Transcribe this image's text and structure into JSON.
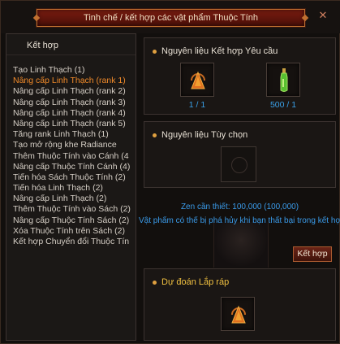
{
  "window": {
    "title": "Tinh chế / kết hợp các vật phẩm Thuộc Tính",
    "close_label": "✕"
  },
  "left": {
    "header": "Kết hợp",
    "items": [
      "Tạo Linh Thạch (1)",
      "Nâng cấp Linh Thạch (rank 1)",
      "Nâng cấp Linh Thạch (rank 2)",
      "Nâng cấp Linh Thạch (rank 3)",
      "Nâng cấp Linh Thạch (rank 4)",
      "Nâng cấp Linh Thạch (rank 5)",
      "Tăng rank Linh Thạch (1)",
      "Tạo mở rộng khe Radiance",
      "Thêm Thuộc Tính vào Cánh (4",
      "Nâng cấp Thuộc Tính Cánh (4)",
      "Tiến hóa Sách Thuộc Tính (2)",
      "Tiến hóa Linh Thạch (2)",
      "Nâng cấp Linh Thạch (2)",
      "Thêm Thuộc Tính vào Sách (2)",
      "Nâng cấp Thuộc Tính Sách (2)",
      "Xóa Thuộc Tính trên Sách (2)",
      "Kết hợp Chuyển đổi Thuộc Tín"
    ],
    "active_index": 1
  },
  "required": {
    "title": "Nguyên liệu Kết hợp Yêu cầu",
    "slots": [
      {
        "icon": "linh-thach-icon",
        "count": "1 / 1"
      },
      {
        "icon": "green-potion-icon",
        "count": "500 / 1"
      }
    ]
  },
  "optional": {
    "title": "Nguyên liệu Tùy chọn"
  },
  "info": {
    "zen": "Zen cần thiết: 100,000 (100,000)",
    "warning": "Vật phẩm có thể bị phá hủy khi bạn thất bại trong kết hợp"
  },
  "actions": {
    "combine_label": "Kết hợp"
  },
  "preview": {
    "title": "Dự đoán Lắp ráp",
    "icon": "linh-thach-icon"
  },
  "colors": {
    "accent_orange": "#f08a2a",
    "info_blue": "#3a9ae8",
    "title_red": "#7a1c10"
  }
}
